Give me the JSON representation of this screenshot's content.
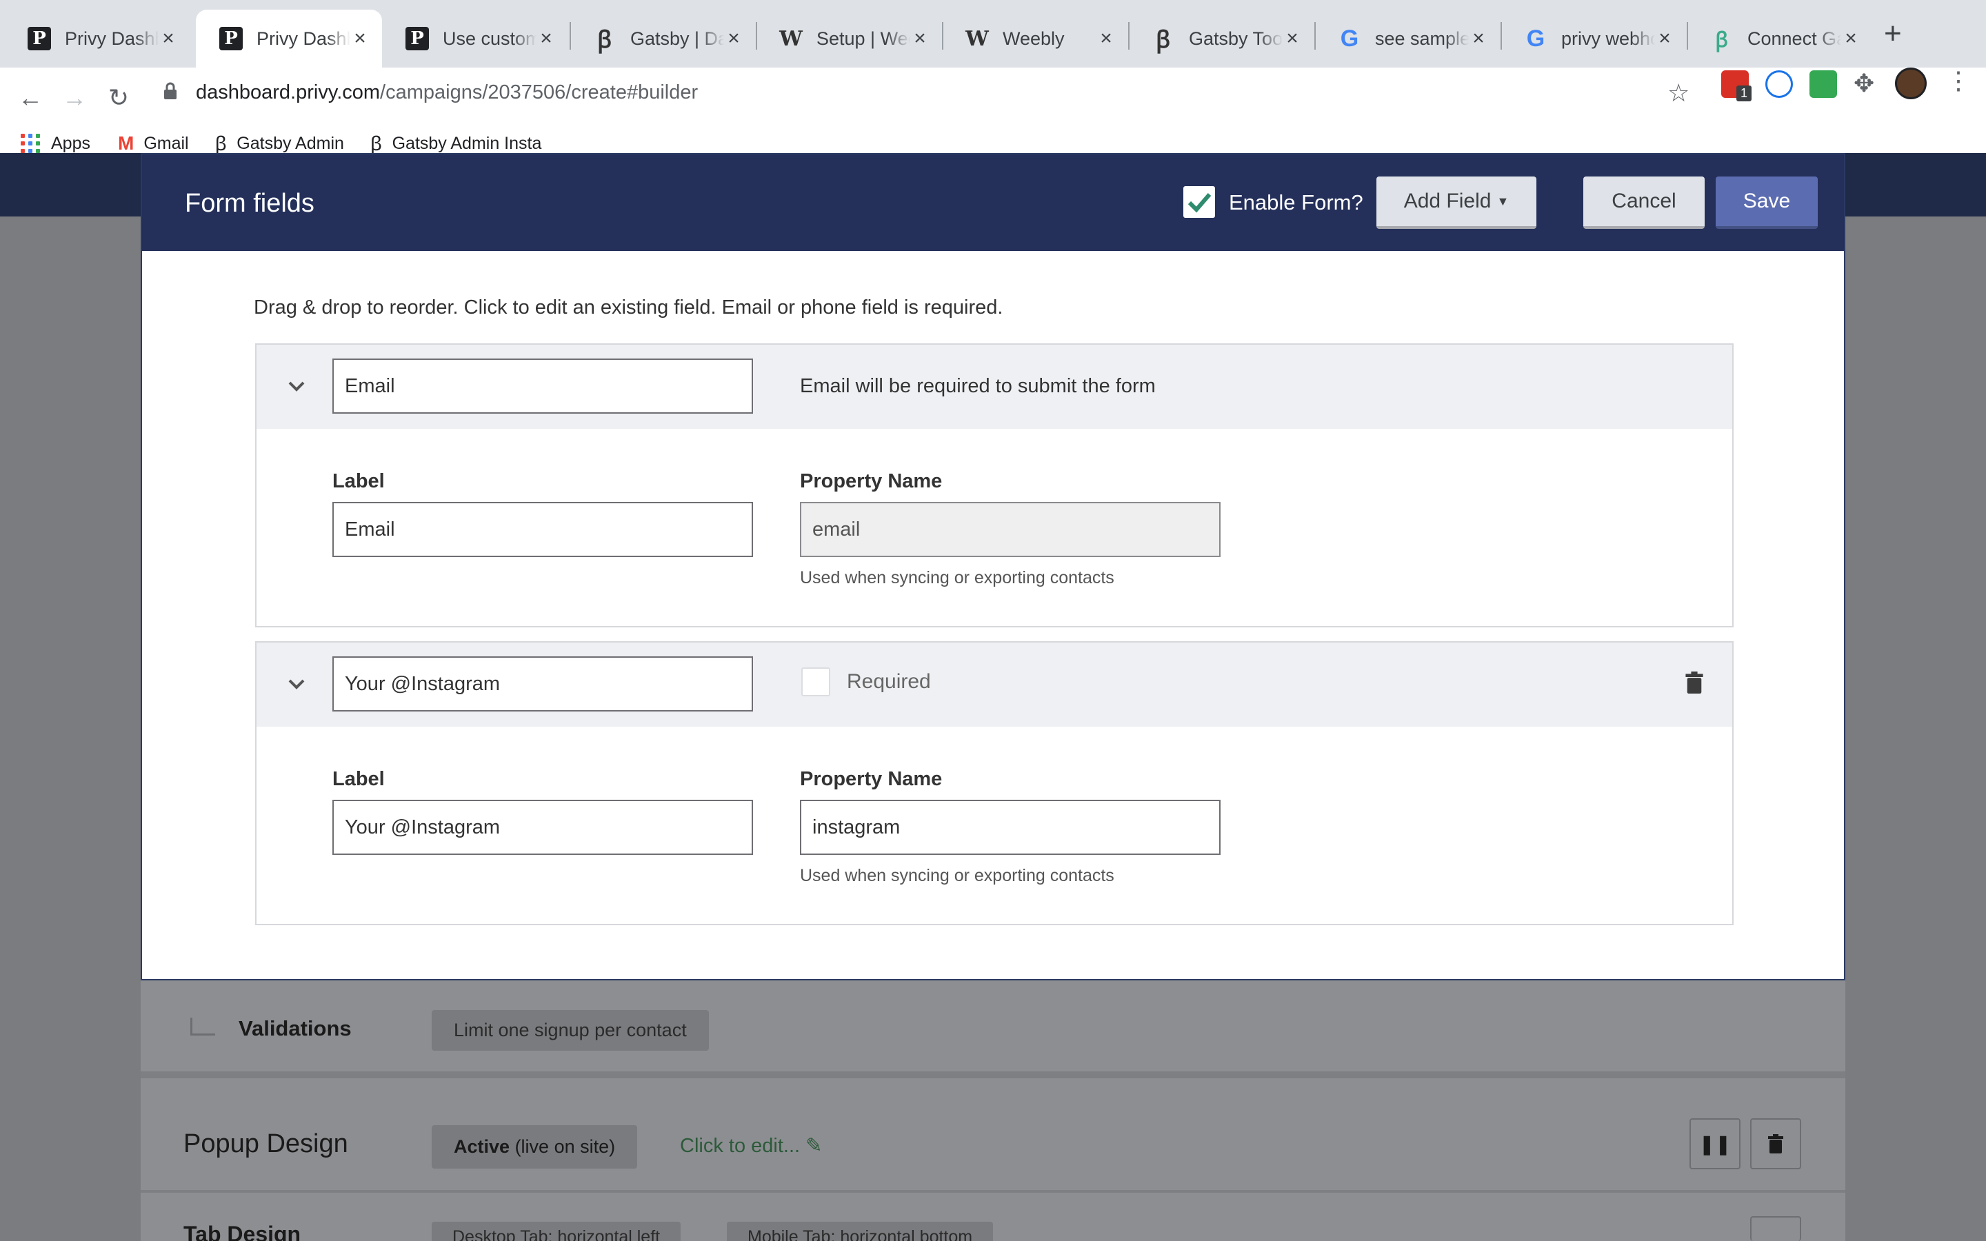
{
  "browser": {
    "tabs": [
      {
        "title": "Privy Dashboard",
        "icon": "privy-icon",
        "active": false
      },
      {
        "title": "Privy Dashboard",
        "icon": "privy-icon",
        "active": true
      },
      {
        "title": "Use custom",
        "icon": "privy-icon",
        "active": false
      },
      {
        "title": "Gatsby | Dat",
        "icon": "gatsby-icon",
        "active": false
      },
      {
        "title": "Setup | Weel",
        "icon": "weebly-icon",
        "active": false
      },
      {
        "title": "Weebly",
        "icon": "weebly-icon",
        "active": false
      },
      {
        "title": "Gatsby Tool",
        "icon": "gatsby-icon",
        "active": false
      },
      {
        "title": "see sample",
        "icon": "google-icon",
        "active": false
      },
      {
        "title": "privy webho",
        "icon": "google-icon",
        "active": false
      },
      {
        "title": "Connect Ga",
        "icon": "connect-icon",
        "active": false
      }
    ],
    "url_host": "dashboard.privy.com",
    "url_path": "/campaigns/2037506/create#builder",
    "extension_badge": "1",
    "bookmarks": [
      {
        "label": "Apps",
        "icon": "apps-grid-icon"
      },
      {
        "label": "Gmail",
        "icon": "gmail-icon"
      },
      {
        "label": "Gatsby Admin",
        "icon": "gatsby-icon"
      },
      {
        "label": "Gatsby Admin Insta",
        "icon": "gatsby-icon"
      }
    ]
  },
  "modal": {
    "title": "Form fields",
    "enable_form_label": "Enable Form?",
    "enable_form_checked": true,
    "add_field_label": "Add Field",
    "cancel_label": "Cancel",
    "save_label": "Save",
    "hint": "Drag & drop to reorder. Click to edit an existing field. Email or phone field is required.",
    "fields": [
      {
        "header_value": "Email",
        "note": "Email will be required to submit the form",
        "label_heading": "Label",
        "label_value": "Email",
        "property_heading": "Property Name",
        "property_value": "email",
        "property_disabled": true,
        "help": "Used when syncing or exporting contacts"
      },
      {
        "header_value": "Your @Instagram",
        "required_label": "Required",
        "required_checked": false,
        "label_heading": "Label",
        "label_value": "Your @Instagram",
        "property_heading": "Property Name",
        "property_value": "instagram",
        "property_disabled": false,
        "help": "Used when syncing or exporting contacts"
      }
    ]
  },
  "background": {
    "validations_label": "Validations",
    "validations_chip": "Limit one signup per contact",
    "popup_design_title": "Popup Design",
    "popup_status_bold": "Active",
    "popup_status_rest": "(live on site)",
    "popup_edit_link": "Click to edit...",
    "tab_design_title": "Tab Design",
    "tab_chip_desktop": "Desktop Tab: horizontal left",
    "tab_chip_mobile": "Mobile Tab: horizontal bottom"
  },
  "colors": {
    "header_navy": "#24305a",
    "save_button": "#5b6cb0",
    "check_green": "#2e8b6e",
    "link_green": "#2c5a3a"
  }
}
